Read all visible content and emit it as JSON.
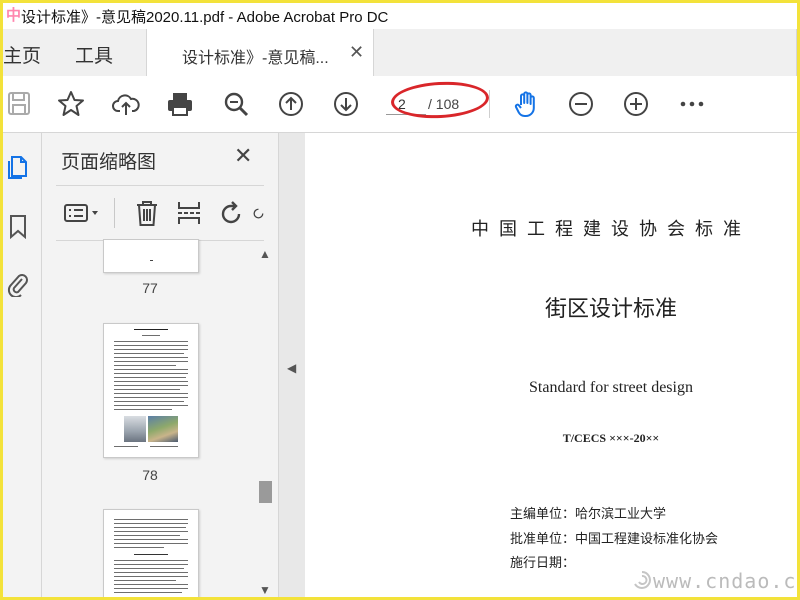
{
  "window": {
    "title": "设计标准》-意见稿2020.11.pdf - Adobe Acrobat Pro DC",
    "logo_text": "中"
  },
  "tabs": {
    "home": "主页",
    "tools": "工具",
    "document": "设计标准》-意见稿...",
    "close_glyph": "✕"
  },
  "toolbar": {
    "icons": [
      "save-icon",
      "bookmark-star-icon",
      "upload-cloud-icon",
      "print-icon",
      "zoom-out-search-icon",
      "page-up-icon",
      "page-down-icon",
      "hand-tool-icon",
      "zoom-out-icon",
      "zoom-in-icon",
      "more-icon"
    ],
    "current_page": "2",
    "total_pages": "/ 108",
    "accent": "#1473e6",
    "annotation_color": "#d9262a"
  },
  "panel": {
    "title": "页面缩略图",
    "close_glyph": "✕",
    "thumbnails": [
      {
        "label": "77"
      },
      {
        "label": "78"
      },
      {
        "label": ""
      }
    ]
  },
  "document": {
    "association": "中国工程建设协会标准",
    "title_cn": "街区设计标准",
    "title_en": "Standard for street design",
    "code": "T/CECS ×××-20××",
    "editor_unit": "主编单位：哈尔滨工业大学",
    "approve_unit": "批准单位：中国工程建设标准化协会",
    "date_label": "施行日期：",
    "watermark": "www.cndao.com"
  }
}
